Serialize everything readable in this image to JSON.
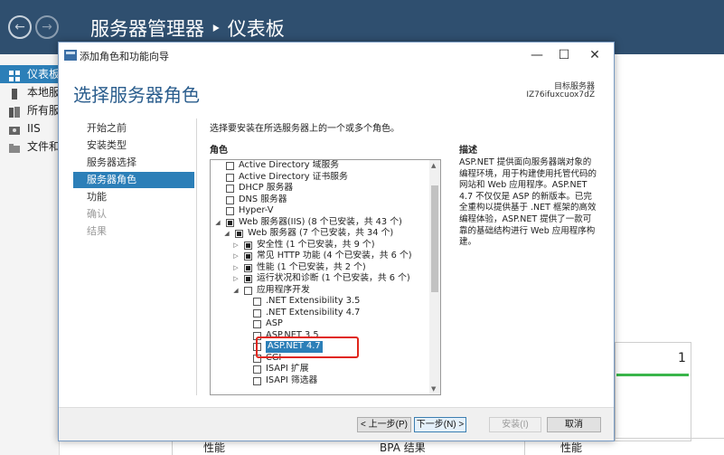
{
  "server_manager": {
    "title": "服务器管理器 ‣ 仪表板",
    "sidebar": [
      {
        "label": "仪表板",
        "active": true
      },
      {
        "label": "本地服务器"
      },
      {
        "label": "所有服务器"
      },
      {
        "label": "IIS"
      },
      {
        "label": "文件和存储服务"
      }
    ],
    "tile_count": "1",
    "bottom_labels": [
      "性能",
      "BPA 结果",
      "性能"
    ]
  },
  "dialog": {
    "window_title": "添加角色和功能向导",
    "page_title": "选择服务器角色",
    "target_label": "目标服务器",
    "target_server": "IZ76ifuxcuox7dZ",
    "steps": [
      {
        "label": "开始之前",
        "state": "normal"
      },
      {
        "label": "安装类型",
        "state": "normal"
      },
      {
        "label": "服务器选择",
        "state": "normal"
      },
      {
        "label": "服务器角色",
        "state": "active"
      },
      {
        "label": "功能",
        "state": "normal"
      },
      {
        "label": "确认",
        "state": "disabled"
      },
      {
        "label": "结果",
        "state": "disabled"
      }
    ],
    "instruction": "选择要安装在所选服务器上的一个或多个角色。",
    "roles_heading": "角色",
    "description_heading": "描述",
    "description": "ASP.NET 提供面向服务器端对象的编程环境，用于构建使用托管代码的网站和 Web 应用程序。ASP.NET 4.7 不仅仅是 ASP 的新版本。已完全重构以提供基于 .NET 框架的高效编程体验，ASP.NET 提供了一款可靠的基础结构进行 Web 应用程序构建。",
    "roles": [
      {
        "label": "Active Directory 域服务",
        "level": 0,
        "expander": "",
        "check": "none"
      },
      {
        "label": "Active Directory 证书服务",
        "level": 0,
        "expander": "",
        "check": "none"
      },
      {
        "label": "DHCP 服务器",
        "level": 0,
        "expander": "",
        "check": "none"
      },
      {
        "label": "DNS 服务器",
        "level": 0,
        "expander": "",
        "check": "none"
      },
      {
        "label": "Hyper-V",
        "level": 0,
        "expander": "",
        "check": "none"
      },
      {
        "label": "Web 服务器(IIS) (8 个已安装，共 43 个)",
        "level": 0,
        "expander": "◢",
        "check": "partial"
      },
      {
        "label": "Web 服务器 (7 个已安装，共 34 个)",
        "level": 1,
        "expander": "◢",
        "check": "partial"
      },
      {
        "label": "安全性 (1 个已安装，共 9 个)",
        "level": 2,
        "expander": "▷",
        "check": "partial"
      },
      {
        "label": "常见 HTTP 功能 (4 个已安装，共 6 个)",
        "level": 2,
        "expander": "▷",
        "check": "partial"
      },
      {
        "label": "性能 (1 个已安装，共 2 个)",
        "level": 2,
        "expander": "▷",
        "check": "partial"
      },
      {
        "label": "运行状况和诊断 (1 个已安装，共 6 个)",
        "level": 2,
        "expander": "▷",
        "check": "partial"
      },
      {
        "label": "应用程序开发",
        "level": 2,
        "expander": "◢",
        "check": "none"
      },
      {
        "label": ".NET Extensibility 3.5",
        "level": 3,
        "expander": "",
        "check": "none"
      },
      {
        "label": ".NET Extensibility 4.7",
        "level": 3,
        "expander": "",
        "check": "none"
      },
      {
        "label": "ASP",
        "level": 3,
        "expander": "",
        "check": "none"
      },
      {
        "label": "ASP.NET 3.5",
        "level": 3,
        "expander": "",
        "check": "none"
      },
      {
        "label": "ASP.NET 4.7",
        "level": 3,
        "expander": "",
        "check": "none",
        "selected": true
      },
      {
        "label": "CGI",
        "level": 3,
        "expander": "",
        "check": "none"
      },
      {
        "label": "ISAPI 扩展",
        "level": 3,
        "expander": "",
        "check": "none"
      },
      {
        "label": "ISAPI 筛选器",
        "level": 3,
        "expander": "",
        "check": "none"
      }
    ],
    "buttons": {
      "prev": "< 上一步(P)",
      "next": "下一步(N) >",
      "install": "安装(I)",
      "cancel": "取消"
    }
  }
}
